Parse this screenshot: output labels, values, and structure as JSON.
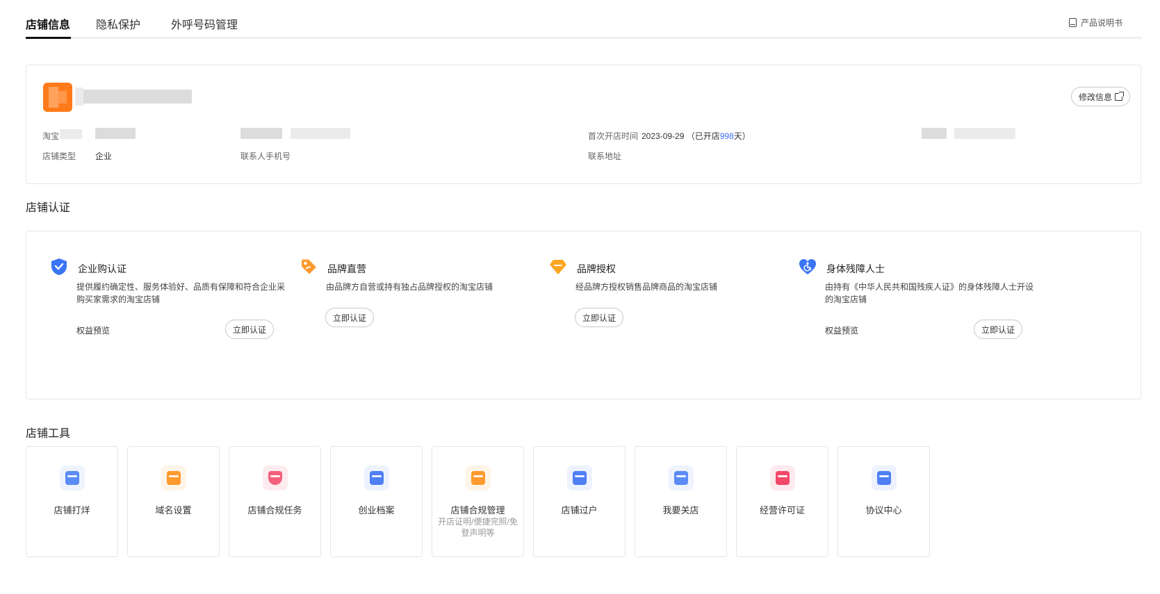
{
  "tabs": {
    "items": [
      "店铺信息",
      "隐私保护",
      "外呼号码管理"
    ],
    "manual_label": "产品说明书"
  },
  "store_info": {
    "edit_label": "修改信息",
    "taobao_label_prefix": "淘宝",
    "store_type_label": "店铺类型",
    "store_type_value": "企业",
    "contact_phone_label": "联系人手机号",
    "first_open_label": "首次开店时间",
    "first_open_date": "2023-09-29",
    "opened_prefix": "（已开店",
    "opened_days": "998",
    "opened_suffix": "天）",
    "address_label": "联系地址"
  },
  "certification": {
    "title": "店铺认证",
    "items": [
      {
        "title": "企业购认证",
        "desc": "提供履约确定性、服务体验好、品质有保障和符合企业采购买家需求的淘宝店铺",
        "rights": "权益预览",
        "action": "立即认证",
        "icon": "shield-check-icon",
        "color": "#3b74f5"
      },
      {
        "title": "品牌直营",
        "desc": "由品牌方自营或持有独占品牌授权的淘宝店铺",
        "rights": "",
        "action": "立即认证",
        "icon": "tag-icon",
        "color": "#ff9a2e"
      },
      {
        "title": "品牌授权",
        "desc": "经品牌方授权销售品牌商品的淘宝店铺",
        "rights": "",
        "action": "立即认证",
        "icon": "diamond-icon",
        "color": "#ffa51f"
      },
      {
        "title": "身体残障人士",
        "desc": "由持有《中华人民共和国残疾人证》的身体残障人士开设的淘宝店铺",
        "rights": "权益预览",
        "action": "立即认证",
        "icon": "heart-accessibility-icon",
        "color": "#3b74f5"
      }
    ]
  },
  "tools": {
    "title": "店铺工具",
    "items": [
      {
        "label": "店铺打烊",
        "sub": "",
        "icon": "store-closed-icon",
        "color": "#5b8cf7"
      },
      {
        "label": "域名设置",
        "sub": "",
        "icon": "domain-icon",
        "color": "#ff9a2e"
      },
      {
        "label": "店铺合规任务",
        "sub": "",
        "icon": "shield-search-icon",
        "color": "#f25f7a"
      },
      {
        "label": "创业档案",
        "sub": "",
        "icon": "archive-icon",
        "color": "#4f7ff5"
      },
      {
        "label": "店铺合规管理",
        "sub": "开店证明/便捷完照/免登声明等",
        "icon": "compliance-doc-icon",
        "color": "#ff9a2e"
      },
      {
        "label": "店铺过户",
        "sub": "",
        "icon": "transfer-icon",
        "color": "#4f7ff5"
      },
      {
        "label": "我要关店",
        "sub": "",
        "icon": "close-store-icon",
        "color": "#5b8cf7"
      },
      {
        "label": "经营许可证",
        "sub": "",
        "icon": "license-folder-icon",
        "color": "#f2486a"
      },
      {
        "label": "协议中心",
        "sub": "",
        "icon": "agreement-icon",
        "color": "#4f7ff5"
      }
    ]
  }
}
